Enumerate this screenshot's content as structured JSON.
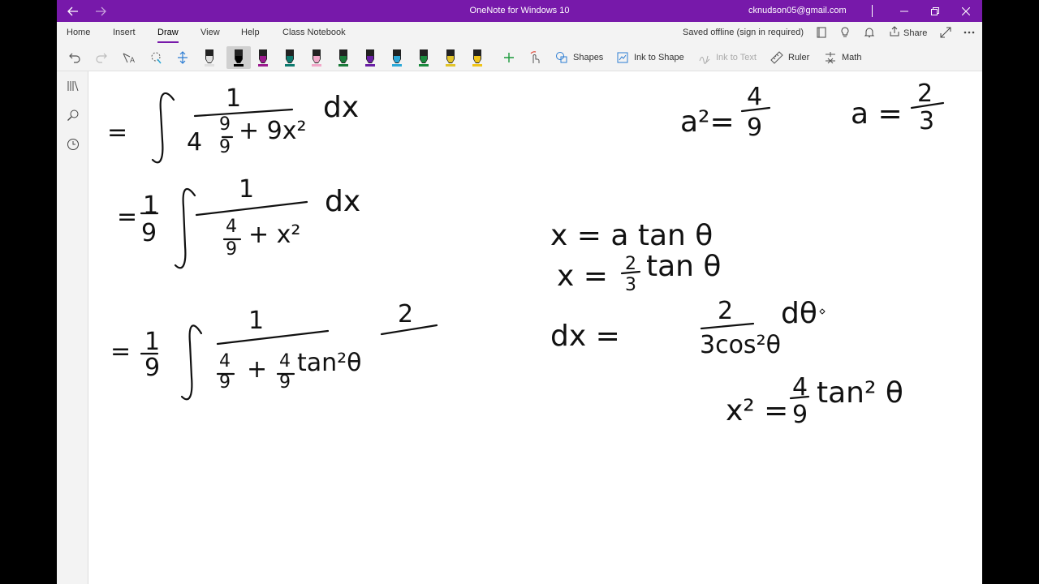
{
  "titlebar": {
    "title": "OneNote for Windows 10",
    "account": "cknudson05@gmail.com"
  },
  "ribbon": {
    "tabs": [
      "Home",
      "Insert",
      "Draw",
      "View",
      "Help",
      "Class Notebook"
    ],
    "active_tab": "Draw",
    "status": "Saved offline (sign in required)",
    "share_label": "Share"
  },
  "toolbar": {
    "shapes_label": "Shapes",
    "ink_to_shape_label": "Ink to Shape",
    "ink_to_text_label": "Ink to Text",
    "ruler_label": "Ruler",
    "math_label": "Math",
    "pen_colors": [
      "#e0e0e0",
      "#000000",
      "#9b1b8e",
      "#0d7a6e",
      "#f2a8c9",
      "#1a7a3a",
      "#6a1fa5",
      "#2ba8d8",
      "#1a8a3e",
      "#e2c42a",
      "#f0c419"
    ]
  },
  "ink": {
    "line1": {
      "eq": "=",
      "num": "1",
      "den_a": "4",
      "frac_n": "9",
      "frac_d": "9",
      "den_b": "+ 9x²",
      "dx": "dx"
    },
    "line2": {
      "eq": "=",
      "coef_n": "1",
      "coef_d": "9",
      "num": "1",
      "den_frac_n": "4",
      "den_frac_d": "9",
      "den_b": "+ x²",
      "dx": "dx"
    },
    "line3": {
      "eq": "=",
      "coef_n": "1",
      "coef_d": "9",
      "num": "1",
      "den_a_n": "4",
      "den_a_d": "9",
      "plus": "+",
      "den_b_n": "4",
      "den_b_d": "9",
      "den_tan": "tan²θ",
      "side_num": "2"
    },
    "a_sq": {
      "lhs": "a²=",
      "n": "4",
      "d": "9"
    },
    "a_val": {
      "lhs": "a =",
      "n": "2",
      "d": "3"
    },
    "sub1": "x = a tan θ",
    "sub2": {
      "lhs": "x =",
      "n": "2",
      "d": "3",
      "rhs": "tan θ"
    },
    "dx_eq": {
      "lhs": "dx =",
      "n": "2",
      "d": "3cos²θ",
      "rhs": "dθ"
    },
    "xsq": {
      "lhs": "x² =",
      "n": "4",
      "d": "9",
      "rhs": "tan² θ"
    }
  }
}
